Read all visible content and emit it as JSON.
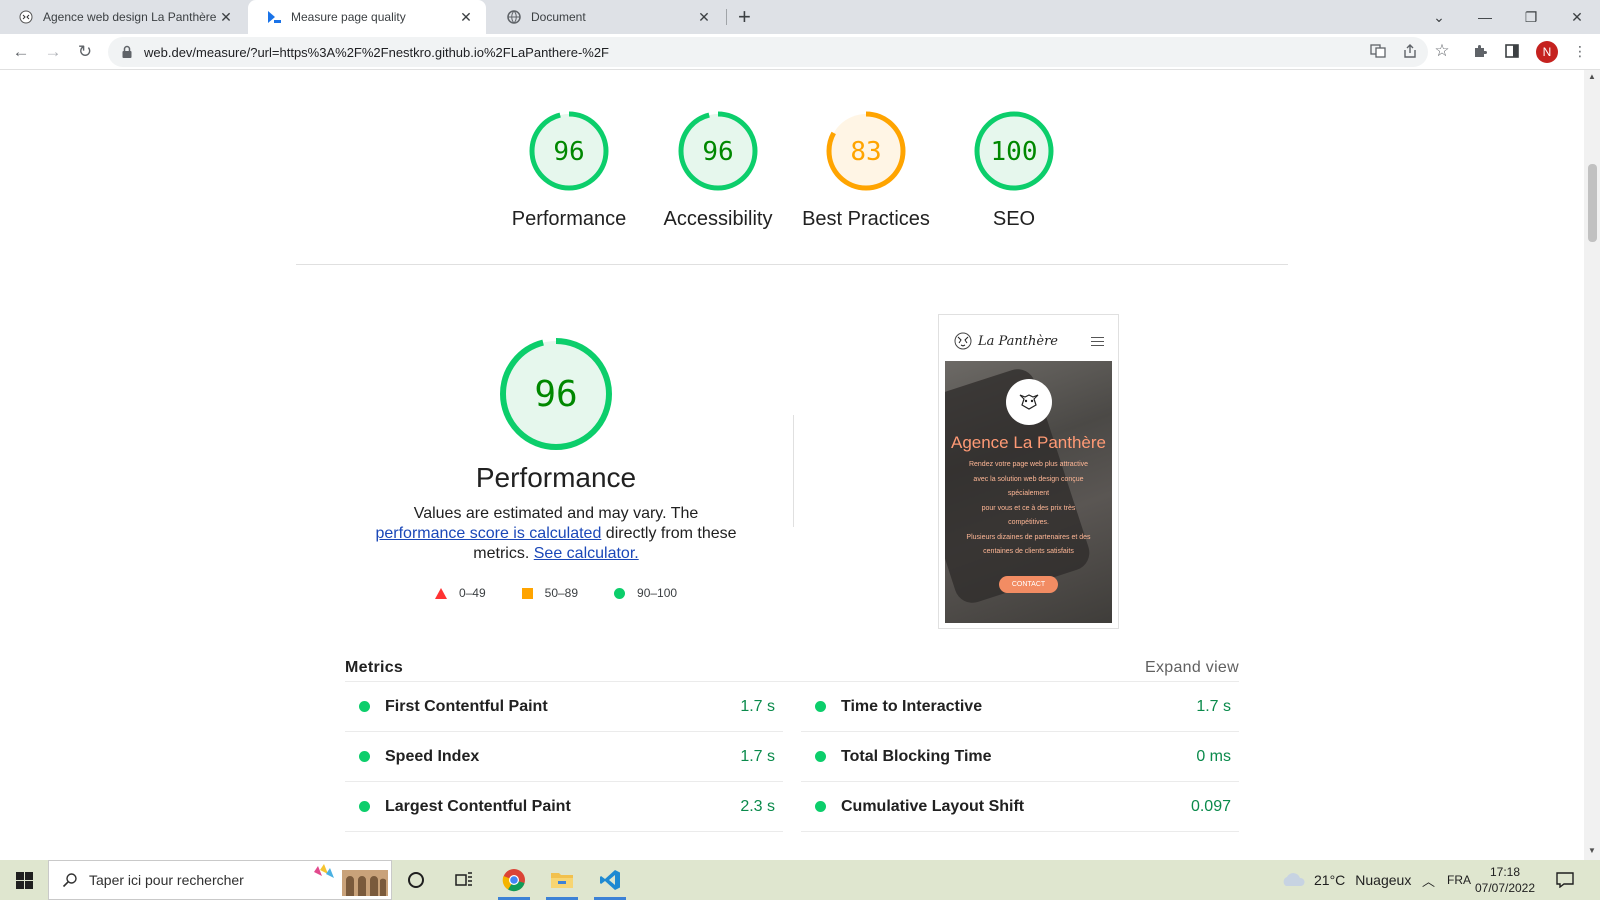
{
  "browser": {
    "tabs": [
      {
        "title": "Agence web design La Panthère",
        "active": false
      },
      {
        "title": "Measure page quality",
        "active": true
      },
      {
        "title": "Document",
        "active": false
      }
    ],
    "url": "web.dev/measure/?url=https%3A%2F%2Fnestkro.github.io%2FLaPanthere-%2F",
    "profile_initial": "N"
  },
  "scores": [
    {
      "label": "Performance",
      "value": "96",
      "score": 96,
      "status": "pass"
    },
    {
      "label": "Accessibility",
      "value": "96",
      "score": 96,
      "status": "pass"
    },
    {
      "label": "Best Practices",
      "value": "83",
      "score": 83,
      "status": "average"
    },
    {
      "label": "SEO",
      "value": "100",
      "score": 100,
      "status": "pass"
    }
  ],
  "colors": {
    "pass": "#0cce6b",
    "pass_fill": "#e6f7ed",
    "pass_text": "#008800",
    "average": "#ffa400",
    "average_fill": "#fff5e5",
    "average_text": "#c33300",
    "fail": "#ff3333"
  },
  "performance": {
    "score": "96",
    "title": "Performance",
    "desc_1": "Values are estimated and may vary. The ",
    "link_1": "performance score is calculated",
    "desc_2": " directly from these metrics. ",
    "link_2": "See calculator.",
    "legend": {
      "fail": "0–49",
      "average": "50–89",
      "pass": "90–100"
    }
  },
  "preview": {
    "site_name": "La Panthère",
    "hero_title": "Agence La Panthère",
    "hero_text": [
      "Rendez votre page web plus attractive",
      "avec la solution web design conçue",
      "spécialement",
      "pour vous et ce à des prix très",
      "compétitives.",
      "Plusieurs dizaines de partenaires et des",
      "centaines de clients satisfaits"
    ],
    "cta": "CONTACT"
  },
  "metrics": {
    "title": "Metrics",
    "expand": "Expand view",
    "left": [
      {
        "name": "First Contentful Paint",
        "value": "1.7 s"
      },
      {
        "name": "Speed Index",
        "value": "1.7 s"
      },
      {
        "name": "Largest Contentful Paint",
        "value": "2.3 s"
      }
    ],
    "right": [
      {
        "name": "Time to Interactive",
        "value": "1.7 s"
      },
      {
        "name": "Total Blocking Time",
        "value": "0 ms"
      },
      {
        "name": "Cumulative Layout Shift",
        "value": "0.097"
      }
    ]
  },
  "taskbar": {
    "search_placeholder": "Taper ici pour rechercher",
    "weather_temp": "21°C",
    "weather_text": "Nuageux",
    "lang": "FRA",
    "time": "17:18",
    "date": "07/07/2022"
  }
}
